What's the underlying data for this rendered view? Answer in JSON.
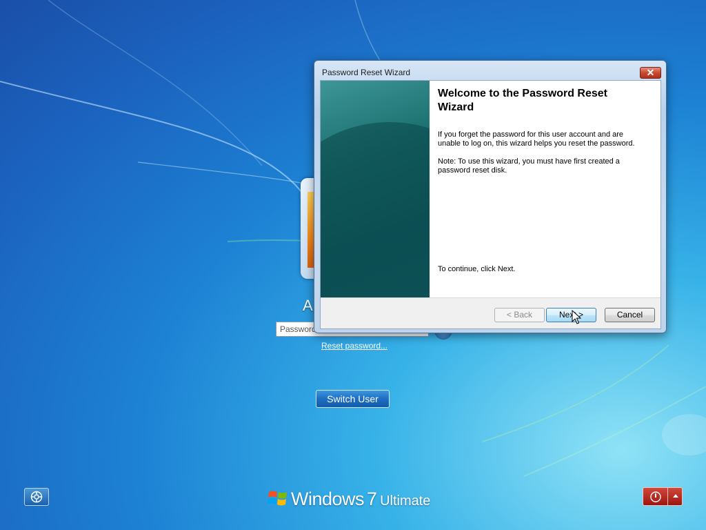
{
  "login": {
    "user_initial": "A",
    "password_placeholder": "Password",
    "reset_link": "Reset password...",
    "switch_user": "Switch User"
  },
  "branding": {
    "windows": "Windows",
    "version": "7",
    "edition": "Ultimate"
  },
  "dialog": {
    "title": "Password Reset Wizard",
    "close_label": "✕",
    "heading": "Welcome to the Password Reset Wizard",
    "paragraph1": "If you forget the password for this user account and are unable to log on, this wizard helps you reset the password.",
    "paragraph2": "Note: To use this wizard, you must have first created a password reset disk.",
    "continue_text": "To continue, click Next.",
    "back_label": "< Back",
    "next_label": "Next >",
    "cancel_label": "Cancel"
  },
  "icons": {
    "ease_of_access": "ease-of-access-icon",
    "power": "power-icon",
    "options_arrow": "chevron-up-icon",
    "windows_flag": "windows-logo-icon"
  },
  "colors": {
    "desktop_blue": "#1d82d4",
    "wizard_banner": "#1b6f6f",
    "power_red": "#b62a22"
  }
}
